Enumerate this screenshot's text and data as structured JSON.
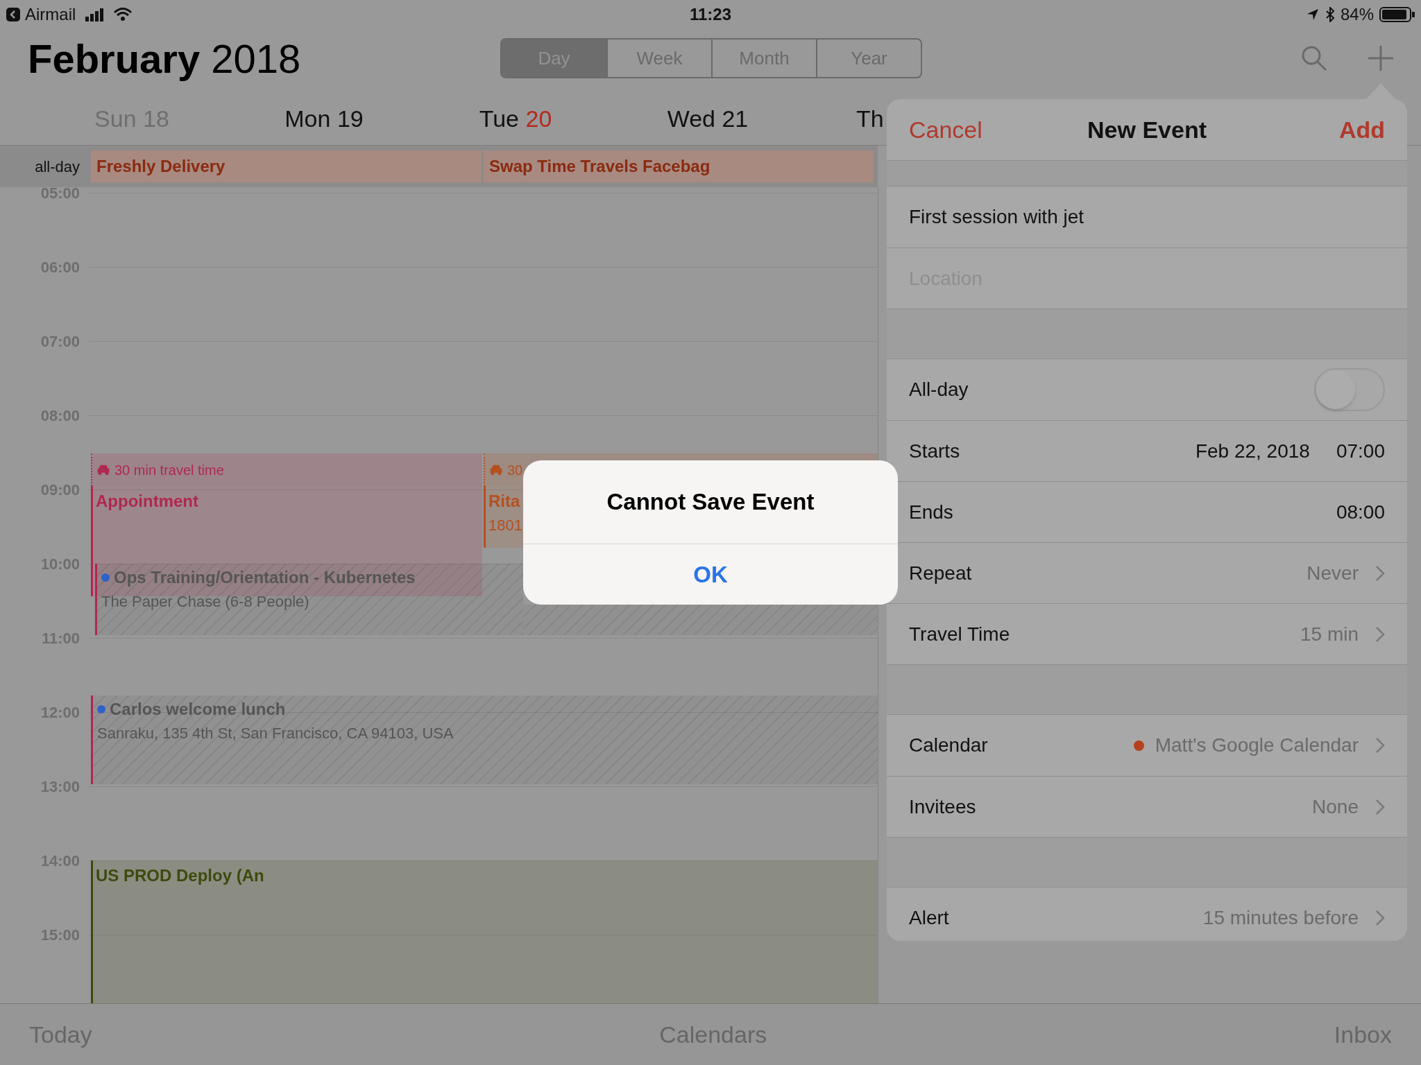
{
  "status_bar": {
    "back_app": "Airmail",
    "time": "11:23",
    "battery": "84%"
  },
  "header": {
    "month": "February",
    "year": "2018"
  },
  "view_tabs": [
    {
      "label": "Day",
      "selected": true
    },
    {
      "label": "Week",
      "selected": false
    },
    {
      "label": "Month",
      "selected": false
    },
    {
      "label": "Year",
      "selected": false
    }
  ],
  "days": [
    {
      "name": "Sun",
      "number": "18",
      "kind": "weekend"
    },
    {
      "name": "Mon",
      "number": "19",
      "kind": "weekday"
    },
    {
      "name": "Tue",
      "number": "20",
      "kind": "today"
    },
    {
      "name": "Wed",
      "number": "21",
      "kind": "weekday"
    },
    {
      "name": "Th",
      "kind": "weekday"
    }
  ],
  "all_day": {
    "label": "all-day",
    "events": [
      {
        "title": "Freshly Delivery"
      },
      {
        "title": "Swap Time Travels Facebag"
      }
    ]
  },
  "hours": [
    "05:00",
    "06:00",
    "07:00",
    "08:00",
    "09:00",
    "10:00",
    "11:00",
    "12:00",
    "13:00",
    "14:00",
    "15:00"
  ],
  "events": [
    {
      "kind": "travel",
      "text": "30 min travel time",
      "color": "#b0284f"
    },
    {
      "kind": "event",
      "title": "Appointment",
      "color": "#b0284f"
    },
    {
      "kind": "travel",
      "text": "30",
      "color": "#b5501f"
    },
    {
      "kind": "event",
      "title": "Rita",
      "detail": "1801",
      "color": "#b5501f"
    },
    {
      "kind": "busy",
      "title": "Ops Training/Orientation - Kubernetes",
      "detail": "The Paper Chase (6-8 People)",
      "color": "#b0284f"
    },
    {
      "kind": "busy",
      "title": "Carlos welcome lunch",
      "detail": "Sanraku, 135 4th St, San Francisco, CA 94103, USA",
      "color": "#b0284f"
    },
    {
      "kind": "event",
      "title": "US PROD Deploy (An",
      "color": "#3d4a0c"
    }
  ],
  "alert": {
    "title": "Cannot Save Event",
    "button": "OK"
  },
  "new_event": {
    "cancel": "Cancel",
    "title": "New Event",
    "add": "Add",
    "groups": [
      [
        {
          "kind": "text",
          "value": "First session with jet"
        },
        {
          "kind": "field",
          "placeholder": "Location"
        }
      ],
      [
        {
          "kind": "toggle",
          "label": "All-day",
          "on": false
        },
        {
          "kind": "value",
          "label": "Starts",
          "value": "Feb 22, 2018",
          "value2": "07:00"
        },
        {
          "kind": "value",
          "label": "Ends",
          "value2": "08:00"
        },
        {
          "kind": "link",
          "label": "Repeat",
          "value": "Never"
        },
        {
          "kind": "link",
          "label": "Travel Time",
          "value": "15 min"
        }
      ],
      [
        {
          "kind": "link",
          "label": "Calendar",
          "value": "Matt's Google Calendar",
          "color": "#b5401f"
        },
        {
          "kind": "link",
          "label": "Invitees",
          "value": "None"
        }
      ],
      [
        {
          "kind": "link",
          "label": "Alert",
          "value": "15 minutes before"
        }
      ]
    ]
  },
  "tab_bar": [
    "Today",
    "Calendars",
    "Inbox"
  ]
}
